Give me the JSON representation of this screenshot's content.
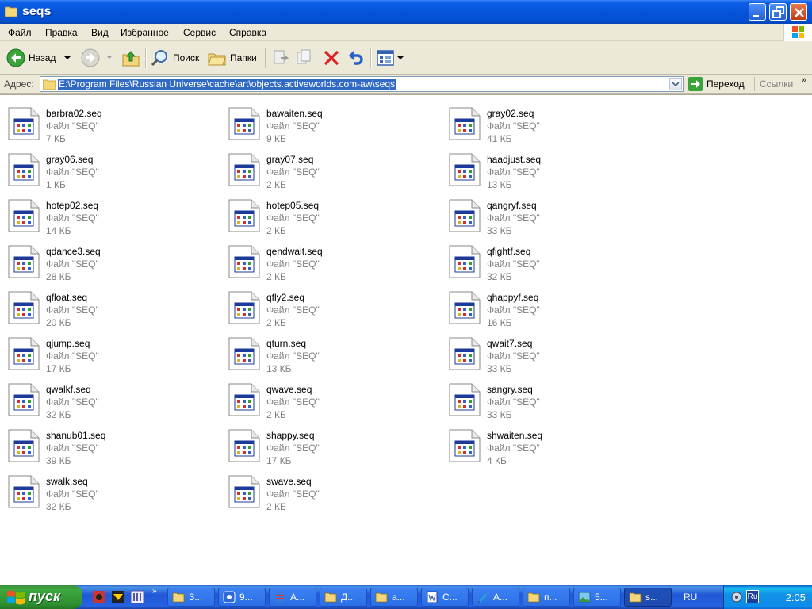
{
  "window": {
    "title": "seqs"
  },
  "menu": [
    "Файл",
    "Правка",
    "Вид",
    "Избранное",
    "Сервис",
    "Справка"
  ],
  "toolbar": {
    "back_label": "Назад",
    "search_label": "Поиск",
    "folders_label": "Папки"
  },
  "address": {
    "label": "Адрес:",
    "path": "E:\\Program Files\\Russian Universe\\cache\\art\\objects.activeworlds.com-aw\\seqs",
    "go_label": "Переход",
    "links_label": "Ссылки"
  },
  "files": [
    {
      "name": "barbra02.seq",
      "type": "Файл \"SEQ\"",
      "size": "7 КБ"
    },
    {
      "name": "bawaiten.seq",
      "type": "Файл \"SEQ\"",
      "size": "9 КБ"
    },
    {
      "name": "gray02.seq",
      "type": "Файл \"SEQ\"",
      "size": "41 КБ"
    },
    {
      "name": "gray06.seq",
      "type": "Файл \"SEQ\"",
      "size": "1 КБ"
    },
    {
      "name": "gray07.seq",
      "type": "Файл \"SEQ\"",
      "size": "2 КБ"
    },
    {
      "name": "haadjust.seq",
      "type": "Файл \"SEQ\"",
      "size": "13 КБ"
    },
    {
      "name": "hotep02.seq",
      "type": "Файл \"SEQ\"",
      "size": "14 КБ"
    },
    {
      "name": "hotep05.seq",
      "type": "Файл \"SEQ\"",
      "size": "2 КБ"
    },
    {
      "name": "qangryf.seq",
      "type": "Файл \"SEQ\"",
      "size": "33 КБ"
    },
    {
      "name": "qdance3.seq",
      "type": "Файл \"SEQ\"",
      "size": "28 КБ"
    },
    {
      "name": "qendwait.seq",
      "type": "Файл \"SEQ\"",
      "size": "2 КБ"
    },
    {
      "name": "qfightf.seq",
      "type": "Файл \"SEQ\"",
      "size": "32 КБ"
    },
    {
      "name": "qfloat.seq",
      "type": "Файл \"SEQ\"",
      "size": "20 КБ"
    },
    {
      "name": "qfly2.seq",
      "type": "Файл \"SEQ\"",
      "size": "2 КБ"
    },
    {
      "name": "qhappyf.seq",
      "type": "Файл \"SEQ\"",
      "size": "16 КБ"
    },
    {
      "name": "qjump.seq",
      "type": "Файл \"SEQ\"",
      "size": "17 КБ"
    },
    {
      "name": "qturn.seq",
      "type": "Файл \"SEQ\"",
      "size": "13 КБ"
    },
    {
      "name": "qwait7.seq",
      "type": "Файл \"SEQ\"",
      "size": "33 КБ"
    },
    {
      "name": "qwalkf.seq",
      "type": "Файл \"SEQ\"",
      "size": "32 КБ"
    },
    {
      "name": "qwave.seq",
      "type": "Файл \"SEQ\"",
      "size": "2 КБ"
    },
    {
      "name": "sangry.seq",
      "type": "Файл \"SEQ\"",
      "size": "33 КБ"
    },
    {
      "name": "shanub01.seq",
      "type": "Файл \"SEQ\"",
      "size": "39 КБ"
    },
    {
      "name": "shappy.seq",
      "type": "Файл \"SEQ\"",
      "size": "17 КБ"
    },
    {
      "name": "shwaiten.seq",
      "type": "Файл \"SEQ\"",
      "size": "4 КБ"
    },
    {
      "name": "swalk.seq",
      "type": "Файл \"SEQ\"",
      "size": "32 КБ"
    },
    {
      "name": "swave.seq",
      "type": "Файл \"SEQ\"",
      "size": "2 КБ"
    }
  ],
  "taskbar": {
    "start_label": "пуск",
    "tasks": [
      {
        "label": "З...",
        "icon": "folder-icon"
      },
      {
        "label": "9...",
        "icon": "app-icon"
      },
      {
        "label": "А...",
        "icon": "globe-icon"
      },
      {
        "label": "Д...",
        "icon": "folder-icon"
      },
      {
        "label": "a...",
        "icon": "folder-icon"
      },
      {
        "label": "C...",
        "icon": "word-icon"
      },
      {
        "label": "А...",
        "icon": "pen-icon"
      },
      {
        "label": "п...",
        "icon": "folder-icon"
      },
      {
        "label": "5...",
        "icon": "image-icon"
      },
      {
        "label": "s...",
        "icon": "folder-icon",
        "active": true
      }
    ],
    "language": "RU",
    "tray_language": "Ru",
    "clock": "2:05"
  },
  "colors": {
    "titlebar": "#0654d9",
    "selection": "#316ac5",
    "chrome": "#ece9d8",
    "start": "#3ea83e"
  }
}
